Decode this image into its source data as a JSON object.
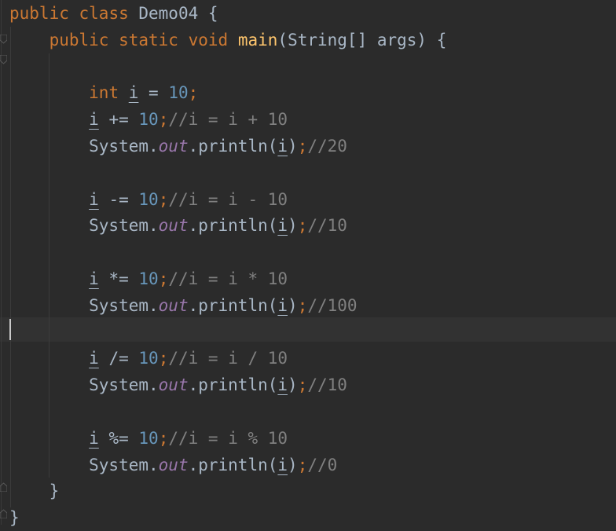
{
  "editor": {
    "colors": {
      "background": "#2b2b2b",
      "current_line": "#323232",
      "keyword": "#cc7832",
      "method": "#ffc66d",
      "number": "#6897bb",
      "field": "#9876aa",
      "comment": "#808080",
      "text": "#a9b7c6"
    },
    "icons": [
      "fold-marker-icon",
      "fold-marker-icon",
      "fold-marker-icon",
      "fold-marker-icon"
    ],
    "lines": [
      {
        "tokens": [
          {
            "t": "public",
            "k": "kw"
          },
          {
            "t": " ",
            "k": "plain"
          },
          {
            "t": "class",
            "k": "kw"
          },
          {
            "t": " Demo04 {",
            "k": "plain"
          }
        ]
      },
      {
        "tokens": [
          {
            "t": "    ",
            "k": "plain"
          },
          {
            "t": "public",
            "k": "kw"
          },
          {
            "t": " ",
            "k": "plain"
          },
          {
            "t": "static",
            "k": "kw"
          },
          {
            "t": " ",
            "k": "plain"
          },
          {
            "t": "void",
            "k": "kw"
          },
          {
            "t": " ",
            "k": "plain"
          },
          {
            "t": "main",
            "k": "fn"
          },
          {
            "t": "(String[] args) {",
            "k": "plain"
          }
        ]
      },
      {
        "tokens": []
      },
      {
        "tokens": [
          {
            "t": "        ",
            "k": "plain"
          },
          {
            "t": "int",
            "k": "kw"
          },
          {
            "t": " ",
            "k": "plain"
          },
          {
            "t": "i",
            "k": "var"
          },
          {
            "t": " = ",
            "k": "plain"
          },
          {
            "t": "10",
            "k": "num"
          },
          {
            "t": ";",
            "k": "semi"
          }
        ]
      },
      {
        "tokens": [
          {
            "t": "        ",
            "k": "plain"
          },
          {
            "t": "i",
            "k": "var"
          },
          {
            "t": " += ",
            "k": "plain"
          },
          {
            "t": "10",
            "k": "num"
          },
          {
            "t": ";",
            "k": "semi"
          },
          {
            "t": "//i = i + 10",
            "k": "cmt"
          }
        ]
      },
      {
        "tokens": [
          {
            "t": "        System.",
            "k": "plain"
          },
          {
            "t": "out",
            "k": "field"
          },
          {
            "t": ".println(",
            "k": "plain"
          },
          {
            "t": "i",
            "k": "var"
          },
          {
            "t": ")",
            "k": "plain"
          },
          {
            "t": ";",
            "k": "semi"
          },
          {
            "t": "//20",
            "k": "cmt"
          }
        ]
      },
      {
        "tokens": []
      },
      {
        "tokens": [
          {
            "t": "        ",
            "k": "plain"
          },
          {
            "t": "i",
            "k": "var"
          },
          {
            "t": " -= ",
            "k": "plain"
          },
          {
            "t": "10",
            "k": "num"
          },
          {
            "t": ";",
            "k": "semi"
          },
          {
            "t": "//i = i - 10",
            "k": "cmt"
          }
        ]
      },
      {
        "tokens": [
          {
            "t": "        System.",
            "k": "plain"
          },
          {
            "t": "out",
            "k": "field"
          },
          {
            "t": ".println(",
            "k": "plain"
          },
          {
            "t": "i",
            "k": "var"
          },
          {
            "t": ")",
            "k": "plain"
          },
          {
            "t": ";",
            "k": "semi"
          },
          {
            "t": "//10",
            "k": "cmt"
          }
        ]
      },
      {
        "tokens": []
      },
      {
        "tokens": [
          {
            "t": "        ",
            "k": "plain"
          },
          {
            "t": "i",
            "k": "var"
          },
          {
            "t": " *= ",
            "k": "plain"
          },
          {
            "t": "10",
            "k": "num"
          },
          {
            "t": ";",
            "k": "semi"
          },
          {
            "t": "//i = i * 10",
            "k": "cmt"
          }
        ]
      },
      {
        "tokens": [
          {
            "t": "        System.",
            "k": "plain"
          },
          {
            "t": "out",
            "k": "field"
          },
          {
            "t": ".println(",
            "k": "plain"
          },
          {
            "t": "i",
            "k": "var"
          },
          {
            "t": ")",
            "k": "plain"
          },
          {
            "t": ";",
            "k": "semi"
          },
          {
            "t": "//100",
            "k": "cmt"
          }
        ]
      },
      {
        "tokens": []
      },
      {
        "tokens": [
          {
            "t": "        ",
            "k": "plain"
          },
          {
            "t": "i",
            "k": "var"
          },
          {
            "t": " /= ",
            "k": "plain"
          },
          {
            "t": "10",
            "k": "num"
          },
          {
            "t": ";",
            "k": "semi"
          },
          {
            "t": "//i = i / 10",
            "k": "cmt"
          }
        ]
      },
      {
        "tokens": [
          {
            "t": "        System.",
            "k": "plain"
          },
          {
            "t": "out",
            "k": "field"
          },
          {
            "t": ".println(",
            "k": "plain"
          },
          {
            "t": "i",
            "k": "var"
          },
          {
            "t": ")",
            "k": "plain"
          },
          {
            "t": ";",
            "k": "semi"
          },
          {
            "t": "//10",
            "k": "cmt"
          }
        ]
      },
      {
        "tokens": []
      },
      {
        "tokens": [
          {
            "t": "        ",
            "k": "plain"
          },
          {
            "t": "i",
            "k": "var"
          },
          {
            "t": " %= ",
            "k": "plain"
          },
          {
            "t": "10",
            "k": "num"
          },
          {
            "t": ";",
            "k": "semi"
          },
          {
            "t": "//i = i % 10",
            "k": "cmt"
          }
        ]
      },
      {
        "tokens": [
          {
            "t": "        System.",
            "k": "plain"
          },
          {
            "t": "out",
            "k": "field"
          },
          {
            "t": ".println(",
            "k": "plain"
          },
          {
            "t": "i",
            "k": "var"
          },
          {
            "t": ")",
            "k": "plain"
          },
          {
            "t": ";",
            "k": "semi"
          },
          {
            "t": "//0",
            "k": "cmt"
          }
        ]
      },
      {
        "tokens": [
          {
            "t": "    }",
            "k": "plain"
          }
        ]
      },
      {
        "tokens": [
          {
            "t": "}",
            "k": "plain"
          }
        ]
      }
    ]
  }
}
